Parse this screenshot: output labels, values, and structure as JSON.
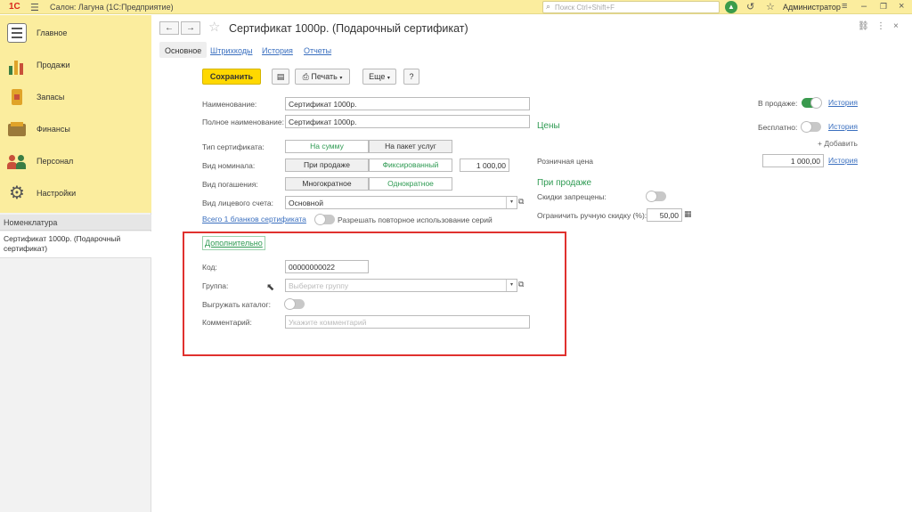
{
  "app": {
    "logo": "1С",
    "title": "Салон: Лагуна  (1С:Предприятие)",
    "search_placeholder": "Поиск Ctrl+Shift+F",
    "user": "Администратор"
  },
  "sidebar": {
    "items": [
      {
        "label": "Главное",
        "icon": "home-icon",
        "color": "#6b6b6b"
      },
      {
        "label": "Продажи",
        "icon": "sales-chart-icon",
        "color": "#3a7d44"
      },
      {
        "label": "Запасы",
        "icon": "inventory-icon",
        "color": "#c9922a"
      },
      {
        "label": "Финансы",
        "icon": "wallet-icon",
        "color": "#8b6b2e"
      },
      {
        "label": "Персонал",
        "icon": "staff-icon",
        "color": "#c8503a"
      },
      {
        "label": "Настройки",
        "icon": "gear-icon",
        "color": "#555555"
      }
    ],
    "section_title": "Номенклатура",
    "section_item": "Сертификат 1000р. (Подарочный сертификат)"
  },
  "document": {
    "title": "Сертификат 1000р. (Подарочный сертификат)",
    "tabs": [
      "Основное",
      "Штрихкоды",
      "История",
      "Отчеты"
    ],
    "toolbar": {
      "save": "Сохранить",
      "print": "Печать",
      "more": "Еще",
      "help": "?"
    }
  },
  "form": {
    "name_label": "Наименование:",
    "name_value": "Сертификат 1000р.",
    "fullname_label": "Полное наименование:",
    "fullname_value": "Сертификат 1000р.",
    "cert_type_label": "Тип сертификата:",
    "cert_type_options": [
      "На сумму",
      "На пакет услуг"
    ],
    "nominal_label": "Вид номинала:",
    "nominal_options": [
      "При продаже",
      "Фиксированный"
    ],
    "nominal_value": "1 000,00",
    "redeem_label": "Вид погашения:",
    "redeem_options": [
      "Многократное",
      "Однократное"
    ],
    "account_label": "Вид лицевого счета:",
    "account_value": "Основной",
    "blanks_link": "Всего 1 бланков сертификата",
    "reuse_label": "Разрешать повторное использование серий"
  },
  "extra": {
    "title": "Дополнительно",
    "code_label": "Код:",
    "code_value": "00000000022",
    "group_label": "Группа:",
    "group_placeholder": "Выберите группу",
    "catalog_label": "Выгружать каталог:",
    "comment_label": "Комментарий:",
    "comment_placeholder": "Укажите комментарий"
  },
  "right": {
    "on_sale_label": "В продаже:",
    "history": "История",
    "prices_title": "Цены",
    "free_label": "Бесплатно:",
    "add_link": "+ Добавить",
    "retail_label": "Розничная цена",
    "retail_value": "1 000,00",
    "at_sale_title": "При продаже",
    "discounts_label": "Скидки запрещены:",
    "manual_discount_label": "Ограничить ручную скидку (%):",
    "manual_discount_value": "50,00"
  }
}
